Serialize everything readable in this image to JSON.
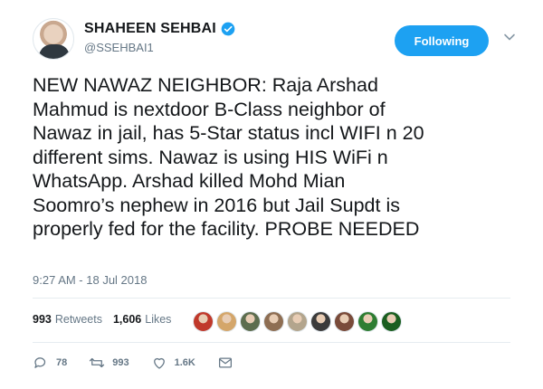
{
  "user": {
    "display_name": "SHAHEEN SEHBAI",
    "handle": "@SSEHBAI1",
    "avatar_icon": "user-avatar",
    "verified_icon": "verified-badge-icon"
  },
  "follow_button": {
    "label": "Following"
  },
  "menu": {
    "icon": "chevron-down-icon"
  },
  "tweet": {
    "text": "NEW NAWAZ NEIGHBOR: Raja Arshad\nMahmud is nextdoor B-Class neighbor of\nNawaz in jail, has 5-Star status incl WIFI n 20\ndifferent sims. Nawaz is using HIS WiFi n\nWhatsApp. Arshad killed Mohd Mian\nSoomro’s nephew in 2016 but Jail Supdt is\nproperly fed for the facility. PROBE NEEDED",
    "timestamp": "9:27 AM - 18 Jul 2018"
  },
  "stats": {
    "retweets_count": "993",
    "retweets_label": "Retweets",
    "likes_count": "1,606",
    "likes_label": "Likes"
  },
  "likers": [
    {
      "color": "#c0392b"
    },
    {
      "color": "#d4a66a"
    },
    {
      "color": "#5d6d4e"
    },
    {
      "color": "#8e6e53"
    },
    {
      "color": "#b3a58d"
    },
    {
      "color": "#3b3b3b"
    },
    {
      "color": "#7a4b3a"
    },
    {
      "color": "#2e7d32"
    },
    {
      "color": "#1b5e20"
    }
  ],
  "actions": {
    "reply_count": "78",
    "retweet_count": "993",
    "like_count": "1.6K"
  },
  "colors": {
    "accent": "#1da1f2",
    "muted": "#657786",
    "text": "#14171a"
  }
}
